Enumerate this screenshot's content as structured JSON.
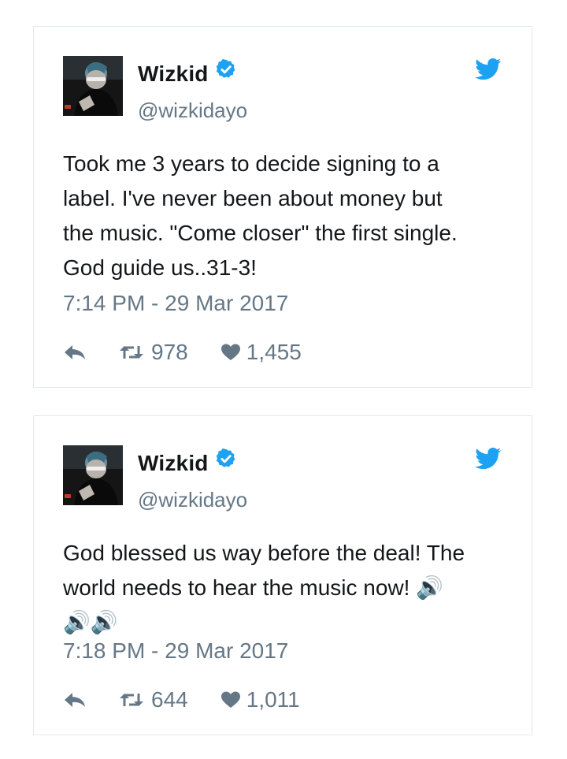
{
  "tweets": [
    {
      "display_name": "Wizkid",
      "handle": "@wizkidayo",
      "text": "Took me 3 years to decide signing to a\nlabel. I've never been about money but\nthe music. \"Come closer\" the first single.\nGod guide us..31-3!",
      "timestamp": "7:14  PM - 29 Mar 2017",
      "retweets": "978",
      "likes": "1,455"
    },
    {
      "display_name": "Wizkid",
      "handle": "@wizkidayo",
      "text": "God blessed us way before the deal! The\nworld needs to hear the music now! 🔊\n🔊🔊",
      "timestamp": "7:18  PM - 29 Mar 2017",
      "retweets": "644",
      "likes": "1,011"
    }
  ],
  "colors": {
    "verified": "#1da1f2",
    "twitter_bird": "#1da1f2",
    "muted": "#657786",
    "border": "#e1e8ed"
  },
  "icons": [
    "verified-badge-icon",
    "twitter-bird-icon",
    "reply-icon",
    "retweet-icon",
    "heart-icon"
  ]
}
